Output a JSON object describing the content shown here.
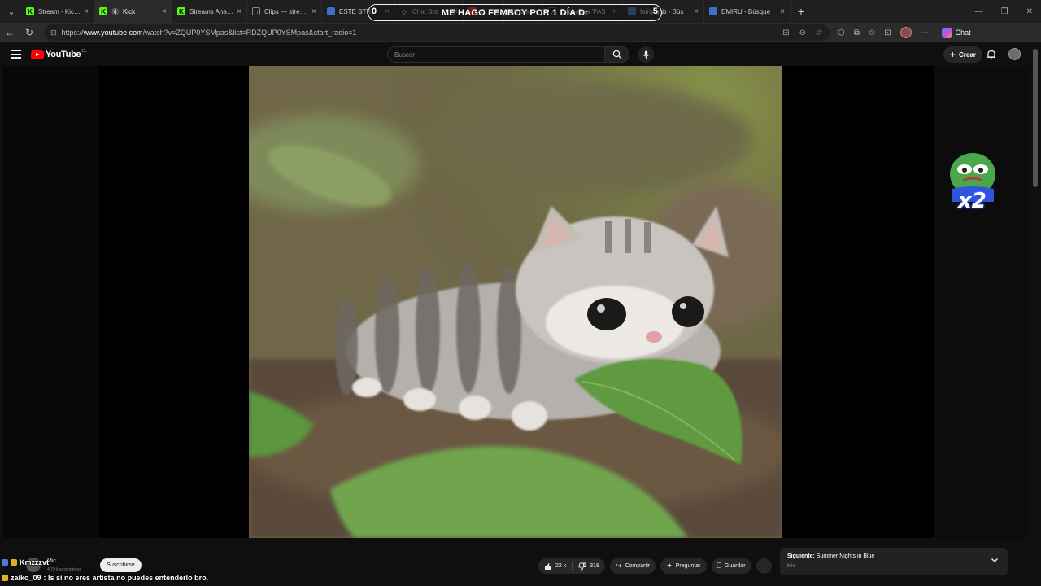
{
  "browser": {
    "tabs": [
      {
        "title": "Stream - Kick D",
        "icon": "kick",
        "active": false
      },
      {
        "title": "Kick",
        "icon": "kick-muted",
        "active": true
      },
      {
        "title": "Streams Analyti",
        "icon": "kick",
        "active": false
      },
      {
        "title": "Clips — stream",
        "icon": "headphones",
        "active": false
      },
      {
        "title": "ESTE STRE",
        "icon": "blue",
        "active": false
      },
      {
        "title": "Chat Bot",
        "icon": "diamond",
        "active": false
      },
      {
        "title": "Crea",
        "icon": "red",
        "active": false
      },
      {
        "title": "VS Cla",
        "icon": "none",
        "active": false
      },
      {
        "title": "Encuentra 'PAS",
        "icon": "tiktok",
        "active": false
      },
      {
        "title": "fairly gab - Bús",
        "icon": "blue",
        "active": false
      },
      {
        "title": "EMIRU - Búsque",
        "icon": "blue",
        "active": false
      }
    ],
    "url_prefix": "https://",
    "url_host": "www.youtube.com",
    "url_path": "/watch?v=ZQUP0YSMpas&list=RDZQUP0YSMpas&start_radio=1",
    "chat_label": "Chat"
  },
  "overlay_banner": {
    "text": "ME HAGO FEMBOY POR 1 DÍA D:",
    "left_count": "0",
    "right_count": "5"
  },
  "youtube": {
    "logo_text": "YouTube",
    "country_code": "CL",
    "search_placeholder": "Buscar",
    "create_label": "Crear"
  },
  "video": {
    "emote_text": "x2"
  },
  "below_video": {
    "channel_name": "Mic",
    "channel_subs": "4,79 k suscriptores",
    "subscribe_label": "Suscribirse",
    "likes": "22 k",
    "dislikes": "318",
    "share_label": "Compartir",
    "ask_label": "Preguntar",
    "save_label": "Guardar",
    "up_next_prefix": "Siguiente:",
    "up_next_title": "Summer Nights in Blue",
    "up_next_artist": "Mic"
  },
  "stream_chat": [
    {
      "user": "Kmzzzvt",
      "message": ""
    },
    {
      "user": "zaiko_09",
      "message": ": Is si no eres artista no puedes entenderlo bro."
    }
  ],
  "colors": {
    "yt_red": "#ff0000",
    "kick_green": "#53fc18",
    "chrome_bg": "#1f1f1f"
  }
}
